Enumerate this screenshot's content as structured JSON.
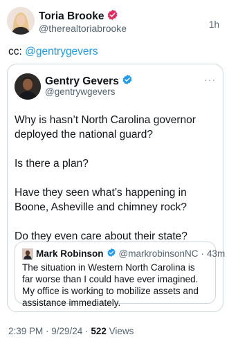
{
  "outer": {
    "name": "Toria Brooke",
    "handle": "@therealtoriabrooke",
    "time": "1h",
    "cc_prefix": "cc: ",
    "cc_mention": "@gentrygevers"
  },
  "quoted": {
    "name": "Gentry Gevers",
    "handle": "@gentrywgevers",
    "more": "···",
    "paragraphs": [
      "Why is hasn’t North Carolina governor deployed the national guard?",
      "Is there a plan?",
      "Have they seen what’s happening in Boone, Asheville and chimney rock?",
      "Do they even care about their state?"
    ]
  },
  "nested": {
    "name": "Mark Robinson",
    "handle": "@markrobinsonNC",
    "separator": "·",
    "time": "43m",
    "text": "The situation in Western North Carolina is far worse than I could have ever imagined. My office is working to mobilize assets and assistance immediately."
  },
  "footer": {
    "timestamp": "2:39 PM · 9/29/24 · ",
    "views_count": "522",
    "views_label": " Views"
  },
  "colors": {
    "link": "#1d9bf0",
    "verified_blue": "#1d9bf0",
    "badge_pink": "#e2285d",
    "border": "#cfd9de",
    "muted": "#536471"
  },
  "icons": {
    "outer_badge": "verified-badge-pink-icon",
    "quoted_badge": "verified-badge-blue-icon",
    "nested_badge": "verified-badge-blue-icon",
    "more": "more-dots-icon"
  }
}
